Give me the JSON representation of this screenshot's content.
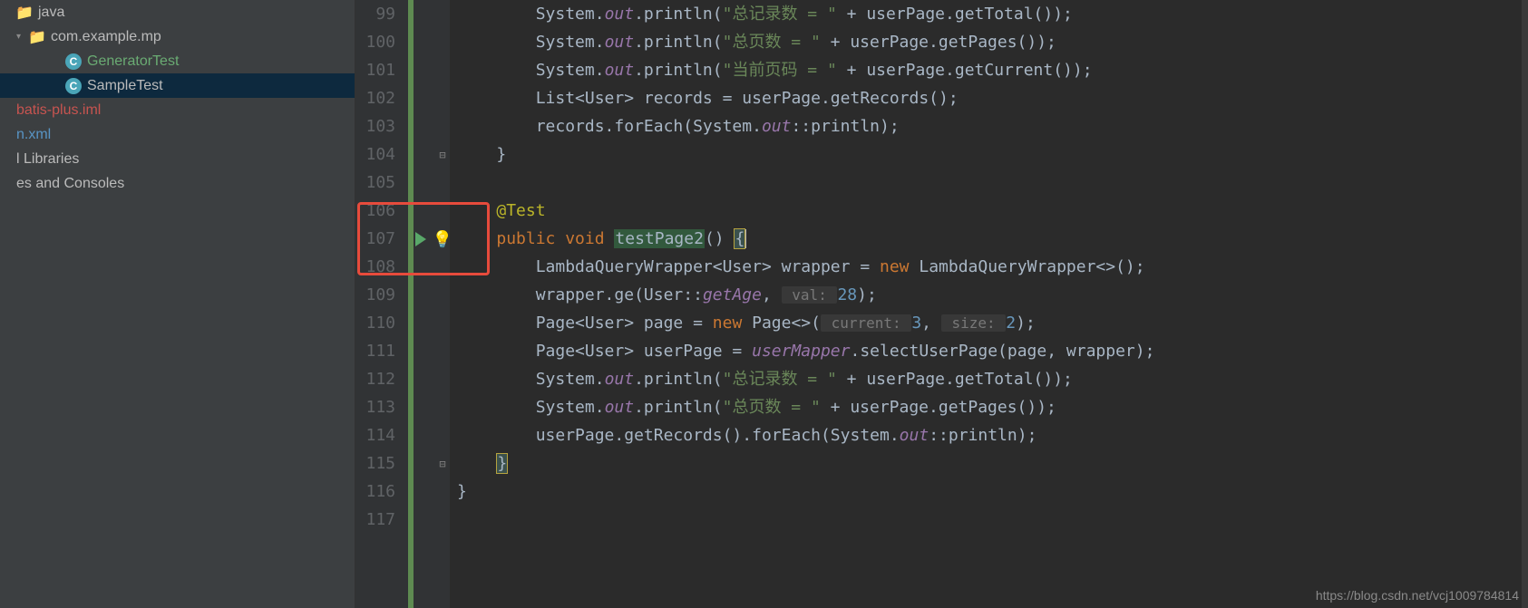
{
  "sidebar": {
    "items": [
      {
        "label": "java",
        "indent": 0,
        "arrow": "",
        "icon": "folder",
        "cls": "grey-text"
      },
      {
        "label": "com.example.mp",
        "indent": 14,
        "arrow": "▾",
        "icon": "folder",
        "cls": "grey-text"
      },
      {
        "label": "GeneratorTest",
        "indent": 54,
        "arrow": "",
        "icon": "class",
        "cls": "green-text"
      },
      {
        "label": "SampleTest",
        "indent": 54,
        "arrow": "",
        "icon": "class",
        "cls": "grey-text",
        "selected": true
      },
      {
        "label": "batis-plus.iml",
        "indent": 0,
        "arrow": "",
        "icon": "",
        "cls": "red-text"
      },
      {
        "label": "n.xml",
        "indent": 0,
        "arrow": "",
        "icon": "",
        "cls": "blue-text"
      },
      {
        "label": "l Libraries",
        "indent": 0,
        "arrow": "",
        "icon": "",
        "cls": "grey-text"
      },
      {
        "label": "es and Consoles",
        "indent": 0,
        "arrow": "",
        "icon": "",
        "cls": "grey-text"
      }
    ]
  },
  "gutter": [
    "99",
    "100",
    "101",
    "102",
    "103",
    "104",
    "105",
    "106",
    "107",
    "108",
    "109",
    "110",
    "111",
    "112",
    "113",
    "114",
    "115",
    "116",
    "117"
  ],
  "fold": {
    "104": "⊟",
    "107": "⊟",
    "115": "⊟"
  },
  "code": [
    [
      [
        "        System.",
        "p"
      ],
      [
        "out",
        "sf"
      ],
      [
        ".println(",
        "p"
      ],
      [
        "\"总记录数 = \"",
        "s"
      ],
      [
        " + userPage.getTotal());",
        "p"
      ]
    ],
    [
      [
        "        System.",
        "p"
      ],
      [
        "out",
        "sf"
      ],
      [
        ".println(",
        "p"
      ],
      [
        "\"总页数 = \"",
        "s"
      ],
      [
        " + userPage.getPages());",
        "p"
      ]
    ],
    [
      [
        "        System.",
        "p"
      ],
      [
        "out",
        "sf"
      ],
      [
        ".println(",
        "p"
      ],
      [
        "\"当前页码 = \"",
        "s"
      ],
      [
        " + userPage.getCurrent());",
        "p"
      ]
    ],
    [
      [
        "        List<User> records = userPage.getRecords();",
        "p"
      ]
    ],
    [
      [
        "        records.forEach(System.",
        "p"
      ],
      [
        "out",
        "sf"
      ],
      [
        "::",
        "p"
      ],
      [
        "println",
        "p"
      ],
      [
        ");",
        "p"
      ]
    ],
    [
      [
        "    }",
        "p"
      ]
    ],
    [
      [
        "",
        "p"
      ]
    ],
    [
      [
        "    ",
        "p"
      ],
      [
        "@Test",
        "a"
      ]
    ],
    [
      [
        "    ",
        "p"
      ],
      [
        "public void ",
        "k"
      ],
      [
        "testPage2",
        "hl"
      ],
      [
        "() ",
        "p"
      ],
      [
        "{",
        "bm"
      ],
      [
        "",
        "cur"
      ]
    ],
    [
      [
        "        LambdaQueryWrapper<User> wrapper = ",
        "p"
      ],
      [
        "new ",
        "k"
      ],
      [
        "LambdaQueryWrapper<>();",
        "p"
      ]
    ],
    [
      [
        "        wrapper.ge(User",
        "p"
      ],
      [
        "::",
        "p"
      ],
      [
        "getAge",
        "sf"
      ],
      [
        ", ",
        "p"
      ],
      [
        " val: ",
        "ph"
      ],
      [
        "28",
        "n"
      ],
      [
        ");",
        "p"
      ]
    ],
    [
      [
        "        Page<User> page = ",
        "p"
      ],
      [
        "new ",
        "k"
      ],
      [
        "Page<>(",
        "p"
      ],
      [
        " current: ",
        "ph"
      ],
      [
        "3",
        "n"
      ],
      [
        ", ",
        "p"
      ],
      [
        " size: ",
        "ph"
      ],
      [
        "2",
        "n"
      ],
      [
        ");",
        "p"
      ]
    ],
    [
      [
        "        Page<User> userPage = ",
        "p"
      ],
      [
        "userMapper",
        "sf"
      ],
      [
        ".selectUserPage(page, wrapper);",
        "p"
      ]
    ],
    [
      [
        "        System.",
        "p"
      ],
      [
        "out",
        "sf"
      ],
      [
        ".println(",
        "p"
      ],
      [
        "\"总记录数 = \"",
        "s"
      ],
      [
        " + userPage.getTotal());",
        "p"
      ]
    ],
    [
      [
        "        System.",
        "p"
      ],
      [
        "out",
        "sf"
      ],
      [
        ".println(",
        "p"
      ],
      [
        "\"总页数 = \"",
        "s"
      ],
      [
        " + userPage.getPages());",
        "p"
      ]
    ],
    [
      [
        "        userPage.getRecords().forEach(System.",
        "p"
      ],
      [
        "out",
        "sf"
      ],
      [
        "::",
        "p"
      ],
      [
        "println",
        "p"
      ],
      [
        ");",
        "p"
      ]
    ],
    [
      [
        "    ",
        "p"
      ],
      [
        "}",
        "bm"
      ]
    ],
    [
      [
        "}",
        "p"
      ]
    ],
    [
      [
        "",
        "p"
      ]
    ]
  ],
  "watermark": "https://blog.csdn.net/vcj1009784814"
}
